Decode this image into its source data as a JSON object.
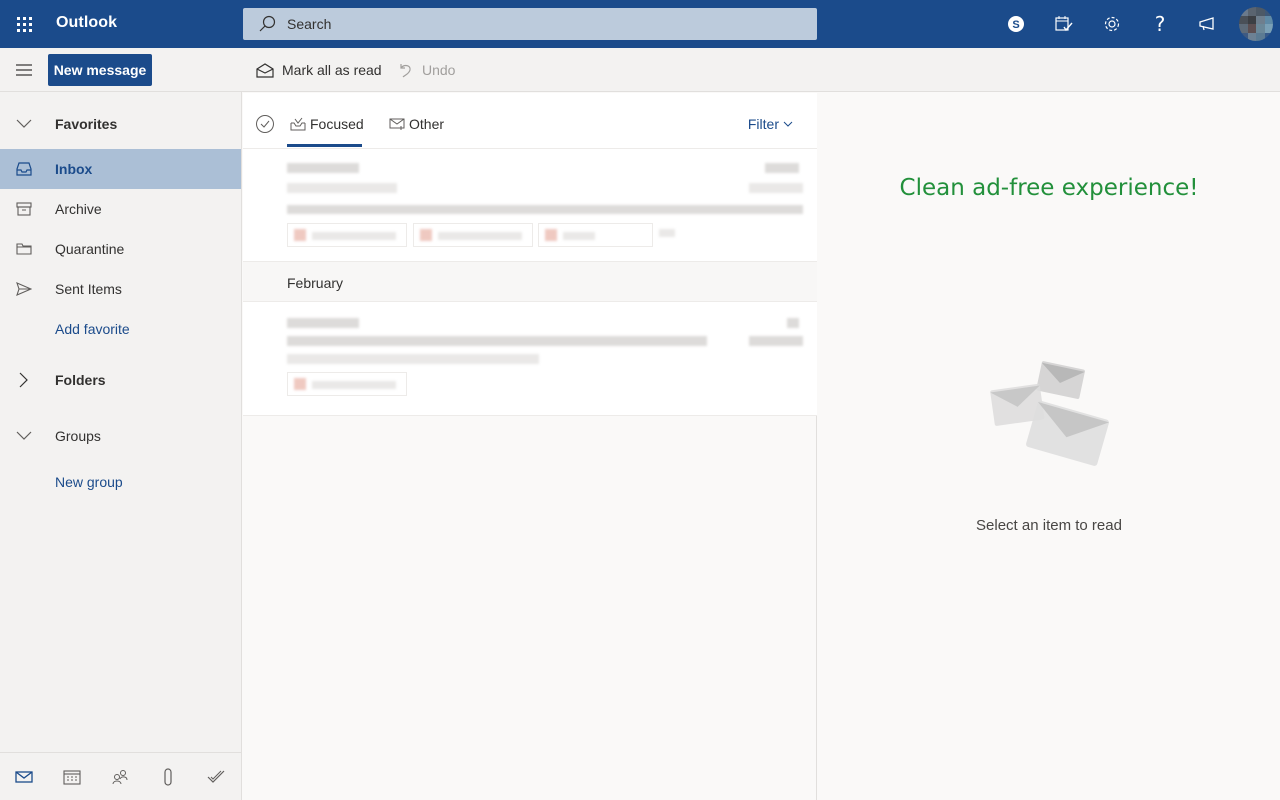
{
  "app": {
    "name": "Outlook",
    "brand_color": "#1b4b8b",
    "accent_color": "#1b4b8b",
    "selected_bg": "#abbfd6"
  },
  "topbar": {
    "search_placeholder": "Search",
    "icons": [
      "skype-icon",
      "my-day-icon",
      "settings-icon",
      "help-icon",
      "feedback-icon",
      "user-avatar"
    ]
  },
  "commandbar": {
    "new_message": "New message",
    "mark_all_read": "Mark all as read",
    "undo": "Undo"
  },
  "nav": {
    "favorites": "Favorites",
    "items": [
      {
        "label": "Inbox",
        "icon": "inbox-icon",
        "selected": true
      },
      {
        "label": "Archive",
        "icon": "archive-icon",
        "selected": false
      },
      {
        "label": "Quarantine",
        "icon": "folder-icon",
        "selected": false
      },
      {
        "label": "Sent Items",
        "icon": "send-icon",
        "selected": false
      }
    ],
    "add_favorite": "Add favorite",
    "folders": "Folders",
    "groups": "Groups",
    "new_group": "New group",
    "bottom_icons": [
      "mail-icon",
      "calendar-icon",
      "people-icon",
      "attachment-icon",
      "todo-icon"
    ]
  },
  "list": {
    "tabs": [
      {
        "label": "Focused",
        "active": true
      },
      {
        "label": "Other",
        "active": false
      }
    ],
    "filter": "Filter",
    "groups": [
      {
        "header": "",
        "messages": [
          {
            "content": "[blurred]",
            "attachments": 3
          }
        ]
      },
      {
        "header": "February",
        "messages": [
          {
            "content": "[blurred]",
            "attachments": 1
          }
        ]
      }
    ]
  },
  "reading": {
    "promo": "Clean ad-free experience!",
    "promo_color": "#22903b",
    "empty_text": "Select an item to read"
  }
}
